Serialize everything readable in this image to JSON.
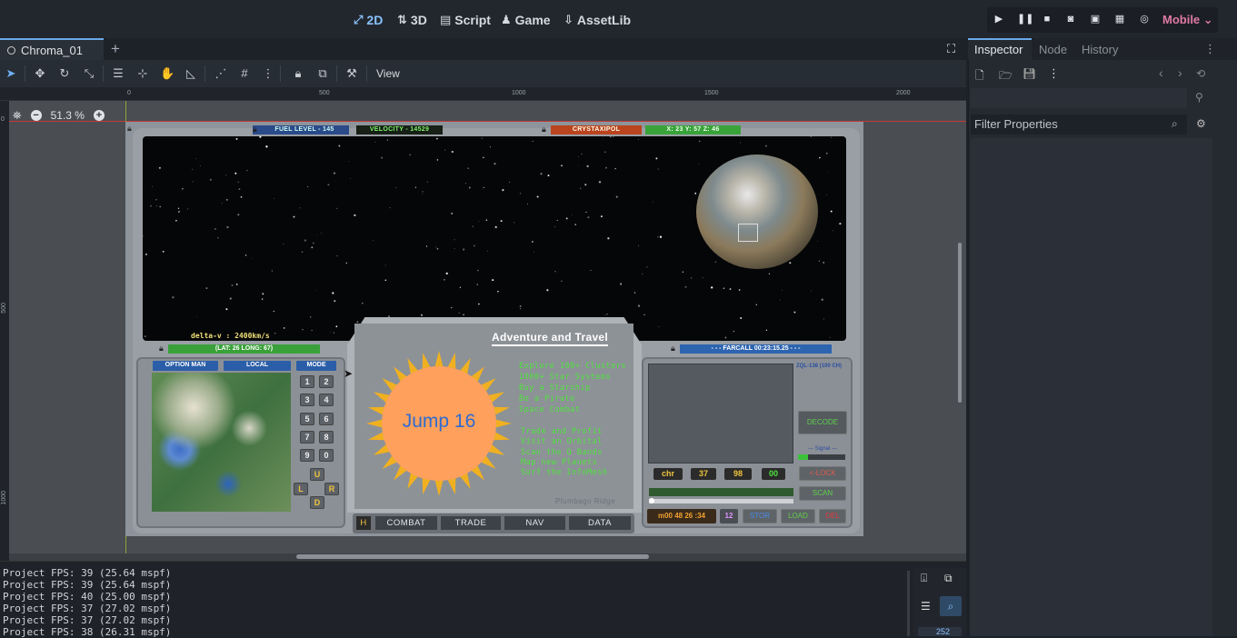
{
  "top_menu": [
    {
      "label": "2D",
      "icon": "2d-icon",
      "active": true
    },
    {
      "label": "3D",
      "icon": "3d-icon",
      "active": false
    },
    {
      "label": "Script",
      "icon": "script-icon",
      "active": false
    },
    {
      "label": "Game",
      "icon": "game-icon",
      "active": false
    },
    {
      "label": "AssetLib",
      "icon": "assetlib-icon",
      "active": false
    }
  ],
  "renderer": "Mobile",
  "scene_tab": {
    "label": "Chroma_01"
  },
  "toolbar": {
    "view_label": "View"
  },
  "zoom": "51.3 %",
  "ruler": {
    "top": [
      "0",
      "500",
      "1000",
      "1500",
      "2000"
    ],
    "left": [
      "0",
      "500",
      "1000"
    ]
  },
  "game": {
    "fuel": "FUEL LEVEL - 145",
    "velocity": "VELOCITY - 14529",
    "planet_name": "CRYSTAXIPOL",
    "coords": "X: 23  Y: 57  Z: 46",
    "delta_v": "delta-v : 2400km/s",
    "latlong": "(LAT: 26 LONG: 67)",
    "farcall": "- - - FARCALL 00:23:15.25 - - -",
    "map_buttons": [
      "OPTION MAN",
      "LOCAL",
      "MODE"
    ],
    "keypad": [
      "1",
      "2",
      "3",
      "4",
      "5",
      "6",
      "7",
      "8",
      "9",
      "0"
    ],
    "dpad": [
      "U",
      "L",
      "R",
      "D"
    ],
    "ad_title": "Adventure and Travel",
    "ad_logo": "Jump 16",
    "ad_lines_1": [
      "Explore 100+ Clusters",
      "1000+ Star Systems",
      "Buy a Starship",
      "Be a Pirate",
      "Space Combat"
    ],
    "ad_lines_2": [
      "Trade and Profit",
      "Visit an Orbital",
      "Scan the Q Bands",
      "Map new Planets",
      "Surf the InfoMesh"
    ],
    "ad_footer": "Plumbago Ridge",
    "nav": {
      "h": "H",
      "combat": "COMBAT",
      "trade": "TRADE",
      "nav": "NAV",
      "data": "DATA"
    },
    "scanner_label": "ZQL-138 (100 CH)",
    "decode": "DECODE",
    "signal": "--- Signal ---",
    "readouts": [
      "chr",
      "37",
      "98",
      "00"
    ],
    "lock": "<-LOCK",
    "scan": "SCAN",
    "time": "m00 48 26 :34",
    "slot": "12",
    "stor": "STOR",
    "load": "LOAD",
    "del": "DEL"
  },
  "console": [
    "Project FPS: 39 (25.64 mspf)",
    "Project FPS: 39 (25.64 mspf)",
    "Project FPS: 40 (25.00 mspf)",
    "Project FPS: 37 (27.02 mspf)",
    "Project FPS: 37 (27.02 mspf)",
    "Project FPS: 38 (26.31 mspf)"
  ],
  "console_count": "252",
  "inspector": {
    "tabs": [
      "Inspector",
      "Node",
      "History"
    ],
    "filter_placeholder": "Filter Properties"
  }
}
